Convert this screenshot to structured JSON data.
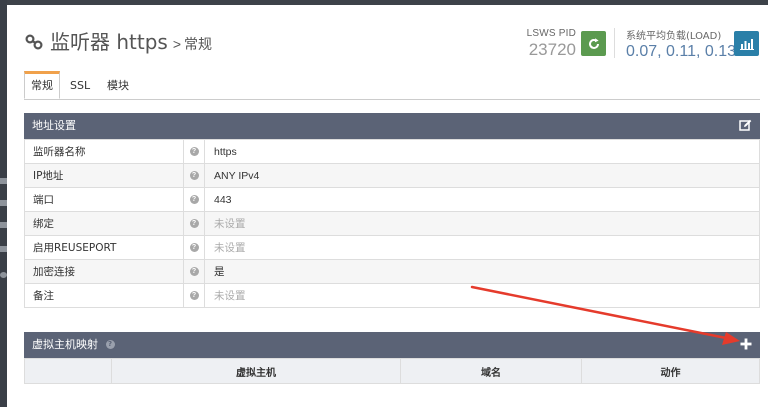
{
  "header": {
    "title": "监听器 https",
    "separator": ">",
    "subtitle": "常规",
    "pid_label": "LSWS PID",
    "pid_value": "23720",
    "load_label": "系统平均负载(LOAD)",
    "load_value": "0.07, 0.11, 0.13"
  },
  "tabs": [
    {
      "label": "常规",
      "active": true
    },
    {
      "label": "SSL",
      "active": false
    },
    {
      "label": "模块",
      "active": false
    }
  ],
  "address_panel": {
    "title": "地址设置",
    "rows": [
      {
        "label": "监听器名称",
        "value": "https",
        "muted": false
      },
      {
        "label": "IP地址",
        "value": "ANY IPv4",
        "muted": false
      },
      {
        "label": "端口",
        "value": "443",
        "muted": false
      },
      {
        "label": "绑定",
        "value": "未设置",
        "muted": true
      },
      {
        "label": "启用REUSEPORT",
        "value": "未设置",
        "muted": true
      },
      {
        "label": "加密连接",
        "value": "是",
        "muted": false
      },
      {
        "label": "备注",
        "value": "未设置",
        "muted": true
      }
    ]
  },
  "vhost_panel": {
    "title": "虚拟主机映射",
    "columns": [
      "虚拟主机",
      "域名",
      "动作"
    ]
  },
  "colors": {
    "panel_header": "#5b6376",
    "tab_accent": "#f0a14b",
    "refresh_button": "#5b9a4f",
    "chart_button": "#2a7fa8",
    "load_value": "#5a7fa8",
    "arrow": "#e53b2c"
  },
  "icons": {
    "title": "link-icon",
    "refresh": "refresh-icon",
    "chart": "bar-chart-icon",
    "edit": "edit-icon",
    "help": "question-icon",
    "add": "plus-icon"
  }
}
